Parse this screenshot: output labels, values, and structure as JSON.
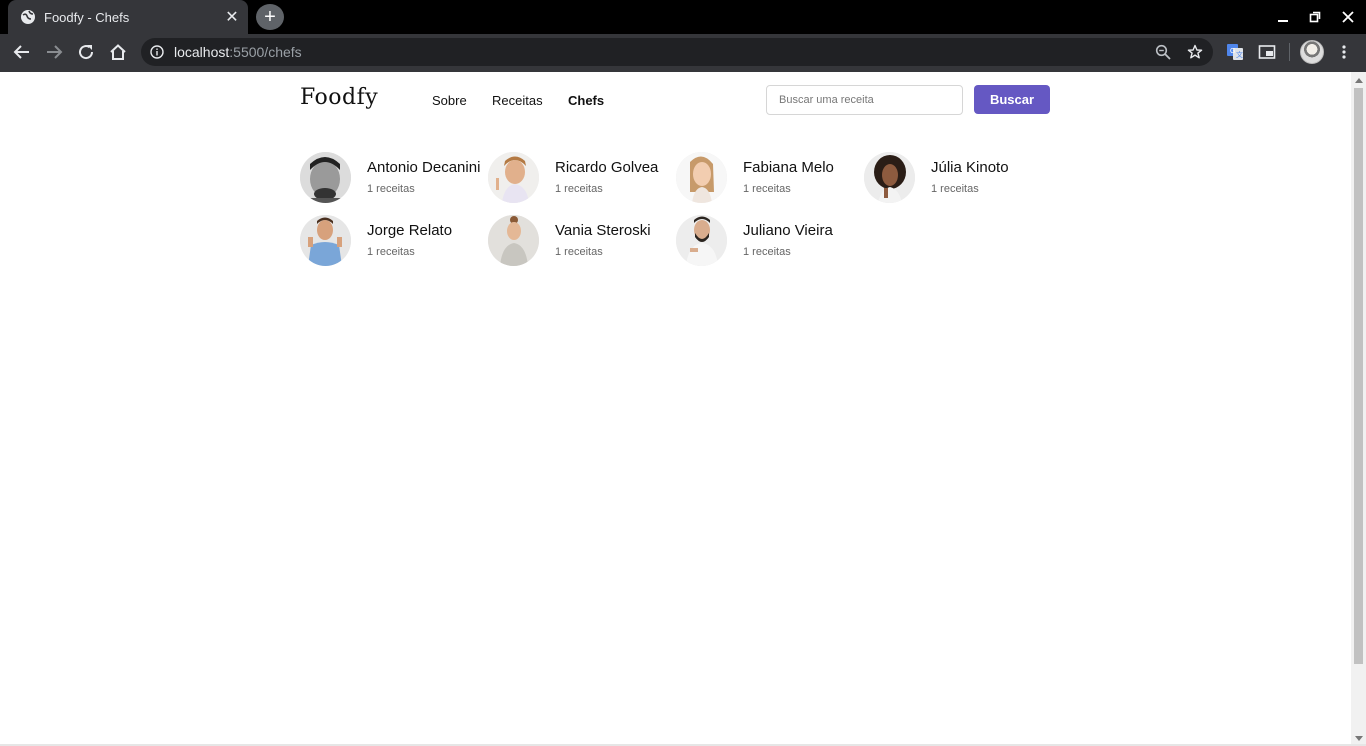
{
  "browser": {
    "tab_title": "Foodfy - Chefs",
    "url_host": "localhost",
    "url_rest": ":5500/chefs",
    "icons": [
      "globe-icon",
      "close-icon",
      "plus-icon",
      "minimize-icon",
      "maximize-icon",
      "close-window-icon",
      "back-icon",
      "forward-icon",
      "reload-icon",
      "home-icon",
      "info-icon",
      "zoom-icon",
      "star-icon",
      "translate-icon",
      "cast-icon",
      "profile-avatar",
      "menu-icon"
    ]
  },
  "header": {
    "logo": "Foodfy",
    "nav": {
      "about": "Sobre",
      "recipes": "Receitas",
      "chefs": "Chefs"
    },
    "search": {
      "placeholder": "Buscar uma receita",
      "button": "Buscar"
    }
  },
  "chefs": [
    {
      "name": "Antonio Decanini",
      "recipes": "1 receitas"
    },
    {
      "name": "Ricardo Golvea",
      "recipes": "1 receitas"
    },
    {
      "name": "Fabiana Melo",
      "recipes": "1 receitas"
    },
    {
      "name": "Júlia Kinoto",
      "recipes": "1 receitas"
    },
    {
      "name": "Jorge Relato",
      "recipes": "1 receitas"
    },
    {
      "name": "Vania Steroski",
      "recipes": "1 receitas"
    },
    {
      "name": "Juliano Vieira",
      "recipes": "1 receitas"
    }
  ],
  "colors": {
    "accent": "#6558c3",
    "chrome_dark": "#35363a",
    "text": "#111111",
    "muted": "#666666"
  }
}
